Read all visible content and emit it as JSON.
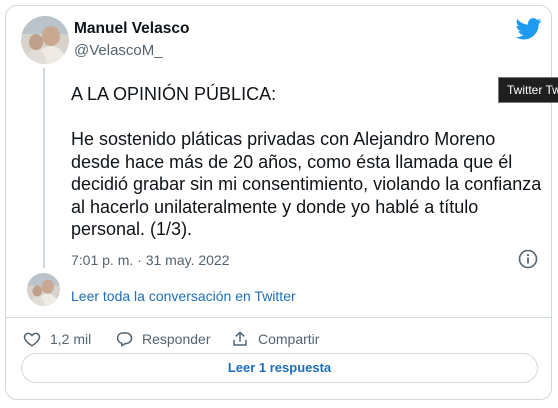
{
  "author": {
    "name": "Manuel Velasco",
    "handle": "@VelascoM_"
  },
  "tooltip": "Twitter Tw",
  "tweet": {
    "heading": "A LA OPINIÓN PÚBLICA:",
    "body": "He sostenido pláticas privadas con Alejandro Moreno desde hace más de 20 años, como ésta llamada que él decidió grabar sin mi consentimiento, violando la confianza al hacerlo unilateralmente y donde yo hablé a título personal. (1/3).",
    "timestamp": "7:01 p. m. · 31 may. 2022"
  },
  "thread_link": "Leer toda la conversación en Twitter",
  "actions": {
    "likes": "1,2 mil",
    "reply": "Responder",
    "share": "Compartir"
  },
  "read_replies": "Leer 1 respuesta",
  "colors": {
    "accent": "#1d9bf0",
    "link": "#1d6fb8",
    "muted": "#536471",
    "border": "#cfd9de"
  },
  "icons": [
    "twitter-bird-icon",
    "info-icon",
    "heart-icon",
    "reply-icon",
    "share-icon"
  ]
}
